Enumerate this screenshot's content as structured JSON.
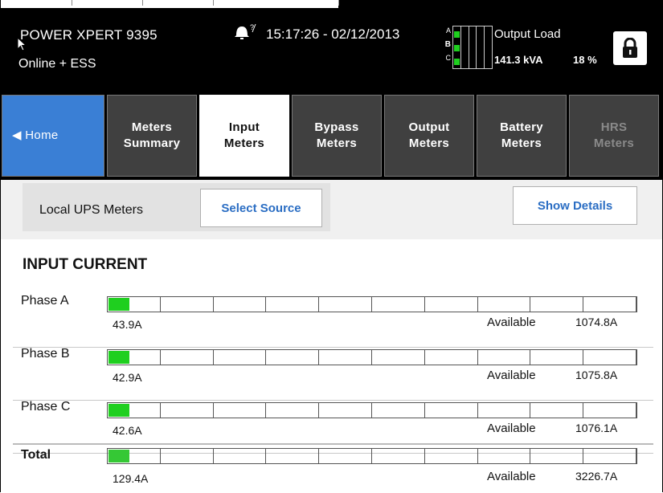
{
  "header": {
    "device_name": "POWER XPERT 9395",
    "status": "Online + ESS",
    "datetime": "15:17:26 - 02/12/2013",
    "phase_labels": [
      "A",
      "B",
      "C"
    ],
    "output_load": {
      "title": "Output Load",
      "kva": "141.3 kVA",
      "percent": "18 %",
      "percent_value": 18
    },
    "icons": [
      "alarm-bell-icon",
      "lock-icon",
      "cursor-arrow-icon"
    ]
  },
  "tabs": [
    {
      "label": "◀ Home",
      "state": "home"
    },
    {
      "label": "Meters\nSummary",
      "state": "normal"
    },
    {
      "label": "Input\nMeters",
      "state": "active"
    },
    {
      "label": "Bypass\nMeters",
      "state": "normal"
    },
    {
      "label": "Output\nMeters",
      "state": "normal"
    },
    {
      "label": "Battery\nMeters",
      "state": "normal"
    },
    {
      "label": "HRS\nMeters",
      "state": "disabled"
    }
  ],
  "toolbar": {
    "local_label": "Local UPS Meters",
    "select_source": "Select Source",
    "show_details": "Show Details"
  },
  "section": {
    "title": "INPUT CURRENT",
    "available_label": "Available",
    "rows": [
      {
        "label": "Phase  A",
        "value": "43.9A",
        "available": "1074.8A",
        "fraction": 0.04
      },
      {
        "label": "Phase  B",
        "value": "42.9A",
        "available": "1075.8A",
        "fraction": 0.04
      },
      {
        "label": "Phase  C",
        "value": "42.6A",
        "available": "1076.1A",
        "fraction": 0.04
      },
      {
        "label": "Total",
        "value": "129.4A",
        "available": "3226.7A",
        "fraction": 0.04
      }
    ]
  },
  "colors": {
    "accent_blue": "#3a7fd5",
    "bar_green": "#1fcf1f",
    "tab_dark": "#404040",
    "header_bg": "#000000",
    "button_text": "#2a6dc3"
  }
}
